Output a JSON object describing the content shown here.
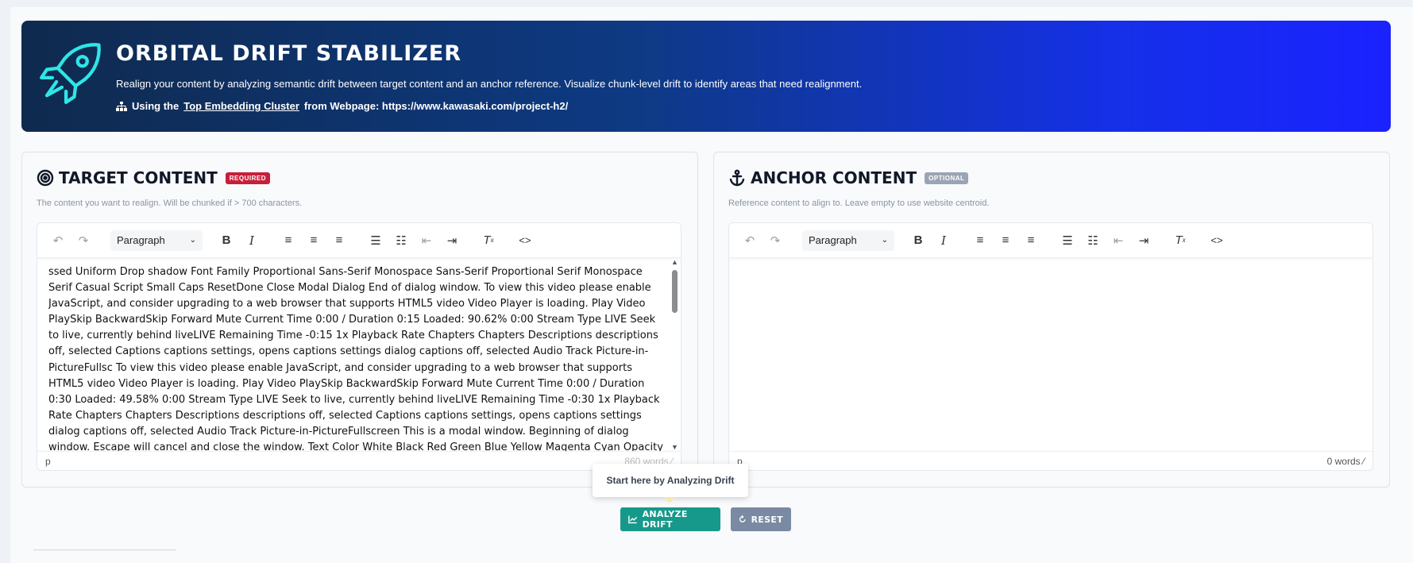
{
  "hero": {
    "title": "ORBITAL DRIFT STABILIZER",
    "description": "Realign your content by analyzing semantic drift between target content and an anchor reference. Visualize chunk-level drift to identify areas that need realignment.",
    "using_prefix": "Using the",
    "using_link": "Top Embedding Cluster",
    "using_suffix": "from Webpage: https://www.kawasaki.com/project-h2/",
    "icon": "rocket-icon"
  },
  "target": {
    "title": "TARGET CONTENT",
    "badge": "REQUIRED",
    "help": "The content you want to realign. Will be chunked if > 700 characters.",
    "block_format": "Paragraph",
    "content": "ssed Uniform Drop shadow Font Family Proportional Sans-Serif Monospace Sans-Serif Proportional Serif Monospace Serif Casual Script Small Caps ResetDone Close Modal Dialog End of dialog window. To view this video please enable JavaScript, and consider upgrading to a web browser that supports HTML5 video Video Player is loading. Play Video PlaySkip BackwardSkip Forward Mute Current Time 0:00 / Duration 0:15 Loaded: 90.62% 0:00 Stream Type LIVE Seek to live, currently behind liveLIVE Remaining Time -0:15 1x Playback Rate Chapters Chapters Descriptions descriptions off, selected Captions captions settings, opens captions settings dialog captions off, selected Audio Track Picture-in-PictureFullsc To view this video please enable JavaScript, and consider upgrading to a web browser that supports HTML5 video Video Player is loading. Play Video PlaySkip BackwardSkip Forward Mute Current Time 0:00 / Duration 0:30 Loaded: 49.58% 0:00 Stream Type LIVE Seek to live, currently behind liveLIVE Remaining Time -0:30 1x Playback Rate Chapters Chapters Descriptions descriptions off, selected Captions captions settings, opens captions settings dialog captions off, selected Audio Track Picture-in-PictureFullscreen This is a modal window. Beginning of dialog window. Escape will cancel and close the window. Text Color White Black Red Green Blue Yellow Magenta Cyan Opacity Opaque",
    "status_path": "p",
    "word_count": "860 words"
  },
  "anchor": {
    "title": "ANCHOR CONTENT",
    "badge": "OPTIONAL",
    "help": "Reference content to align to. Leave empty to use website centroid.",
    "block_format": "Paragraph",
    "content": "",
    "status_path": "p",
    "word_count": "0 words"
  },
  "tooltip": "Start here by Analyzing Drift",
  "actions": {
    "analyze": "ANALYZE DRIFT",
    "reset": "RESET"
  },
  "colors": {
    "hero_start": "#0f2a4e",
    "hero_end": "#1a22ff",
    "rocket": "#2ee6e6",
    "required": "#c81e3a",
    "optional": "#9aa5b4",
    "analyze": "#16998a",
    "reset": "#7b8aa3"
  }
}
